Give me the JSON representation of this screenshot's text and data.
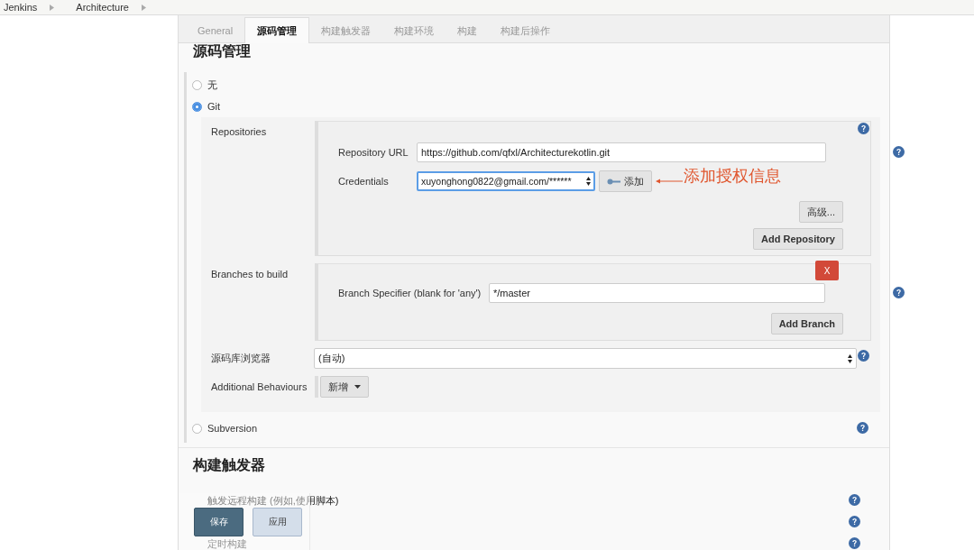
{
  "breadcrumbs": [
    "Jenkins",
    "Architecture"
  ],
  "tabs": [
    {
      "label": "General",
      "selected": false
    },
    {
      "label": "源码管理",
      "selected": true
    },
    {
      "label": "构建触发器",
      "selected": false
    },
    {
      "label": "构建环境",
      "selected": false
    },
    {
      "label": "构建",
      "selected": false
    },
    {
      "label": "构建后操作",
      "selected": false
    }
  ],
  "scm": {
    "heading": "源码管理",
    "options": [
      {
        "label": "无",
        "selected": false
      },
      {
        "label": "Git",
        "selected": true
      }
    ],
    "repositories_label": "Repositories",
    "repository_url": {
      "label": "Repository URL",
      "value": "https://github.com/qfxl/Architecturekotlin.git"
    },
    "credentials": {
      "label": "Credentials",
      "value": "xuyonghong0822@gmail.com/******",
      "add_button": "添加"
    },
    "advanced_button": "高级...",
    "add_repository_button": "Add Repository",
    "branches_label": "Branches to build",
    "delete_button": "X",
    "branch_specifier": {
      "label": "Branch Specifier (blank for 'any')",
      "value": "*/master"
    },
    "add_branch_button": "Add Branch",
    "browser": {
      "label": "源码库浏览器",
      "value": "(自动)"
    },
    "behaviours": {
      "label": "Additional Behaviours",
      "button": "新增"
    },
    "other_options": [
      {
        "label": "Subversion",
        "selected": false
      }
    ]
  },
  "annotation": "添加授权信息",
  "triggers": {
    "heading": "构建触发器",
    "items": [
      {
        "label": "触发远程构建 (例如,使用脚本)",
        "help": true
      },
      {
        "help": true
      },
      {
        "label": "定时构建",
        "help": true
      }
    ]
  },
  "bottom_bar": {
    "save": "保存",
    "apply": "应用"
  }
}
